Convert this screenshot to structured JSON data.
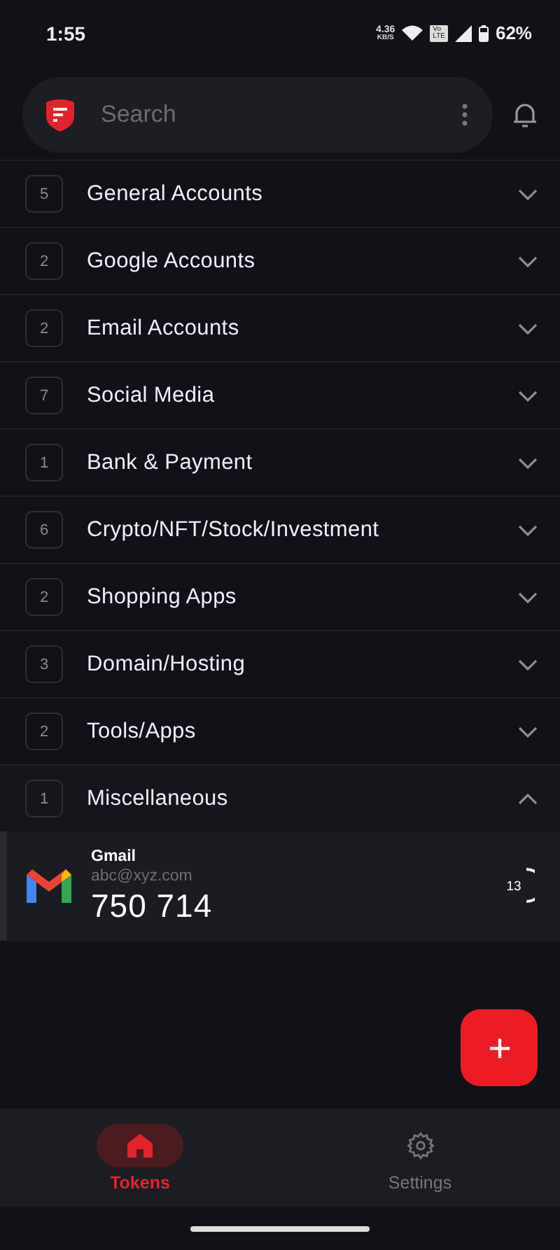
{
  "status_bar": {
    "time": "1:55",
    "speed_value": "4.36",
    "speed_unit": "KB/S",
    "volte_top": "Vo",
    "volte_bottom": "LTE",
    "battery": "62%"
  },
  "search": {
    "placeholder": "Search"
  },
  "groups": [
    {
      "count": "5",
      "name": "General Accounts",
      "expanded": false
    },
    {
      "count": "2",
      "name": "Google Accounts",
      "expanded": false
    },
    {
      "count": "2",
      "name": "Email Accounts",
      "expanded": false
    },
    {
      "count": "7",
      "name": "Social Media",
      "expanded": false
    },
    {
      "count": "1",
      "name": "Bank & Payment",
      "expanded": false
    },
    {
      "count": "6",
      "name": "Crypto/NFT/Stock/Investment",
      "expanded": false
    },
    {
      "count": "2",
      "name": "Shopping Apps",
      "expanded": false
    },
    {
      "count": "3",
      "name": "Domain/Hosting",
      "expanded": false
    },
    {
      "count": "2",
      "name": "Tools/Apps",
      "expanded": false
    },
    {
      "count": "1",
      "name": "Miscellaneous",
      "expanded": true,
      "tokens": [
        {
          "issuer": "Gmail",
          "account": "abc@xyz.com",
          "code": "750 714",
          "seconds": "13"
        }
      ]
    }
  ],
  "nav": [
    {
      "label": "Tokens",
      "kind": "home",
      "selected": true
    },
    {
      "label": "Settings",
      "kind": "settings",
      "selected": false
    }
  ]
}
